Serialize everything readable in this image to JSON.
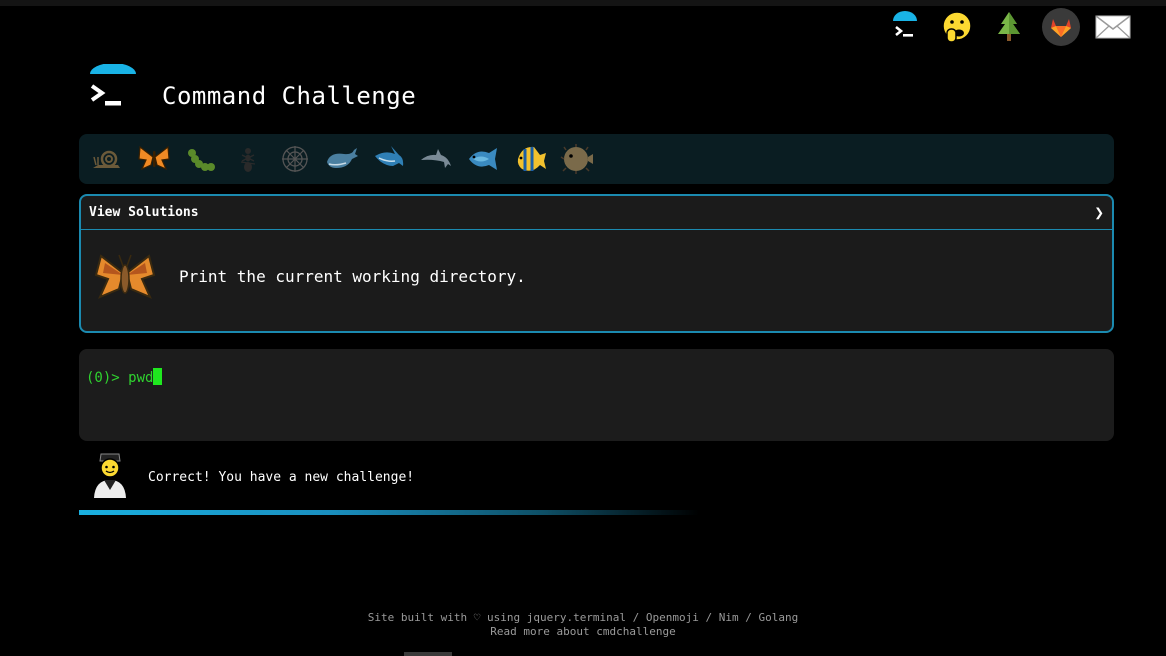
{
  "app": {
    "title": "Command Challenge"
  },
  "top_icons": [
    "terminal-icon",
    "shushing-face-icon",
    "tree-icon",
    "gitlab-icon",
    "envelope-icon"
  ],
  "animals": [
    "snail",
    "butterfly",
    "caterpillar",
    "ant",
    "spider-web",
    "whale",
    "shark",
    "dolphin",
    "fish",
    "tropical-fish",
    "blowfish"
  ],
  "challenge": {
    "header_label": "View Solutions",
    "expand_glyph": "❯",
    "description": "Print the current working directory."
  },
  "terminal": {
    "prompt": "(0)>",
    "input": "pwd"
  },
  "feedback": {
    "message": "Correct! You have a new challenge!",
    "progress": 0.6
  },
  "footer": {
    "line1": "Site built with ♡ using jquery.terminal / Openmoji / Nim / Golang",
    "line2": "Read more about cmdchallenge"
  },
  "colors": {
    "accent": "#1b8ab0",
    "terminal_text": "#2fd32f",
    "bar_bg": "#0a1d22"
  }
}
